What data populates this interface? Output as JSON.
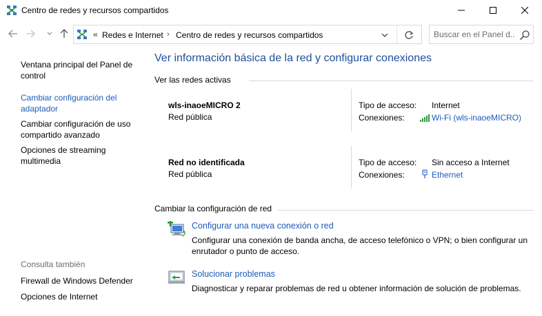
{
  "window": {
    "title": "Centro de redes y recursos compartidos",
    "icon": "network-sharing-center-icon"
  },
  "address_bar": {
    "overflow": "«",
    "breadcrumbs": [
      "Redes e Internet",
      "Centro de redes y recursos compartidos"
    ],
    "search_placeholder": "Buscar en el Panel d..."
  },
  "sidebar": {
    "links": [
      "Ventana principal del Panel de control",
      "Cambiar configuración del adaptador",
      "Cambiar configuración de uso compartido avanzado",
      "Opciones de streaming multimedia"
    ],
    "see_also_label": "Consulta también",
    "see_also": [
      "Firewall de Windows Defender",
      "Opciones de Internet"
    ]
  },
  "main": {
    "title": "Ver información básica de la red y configurar conexiones",
    "active_networks_label": "Ver las redes activas",
    "networks": [
      {
        "name": "wls-inaoeMICRO 2",
        "category": "Red pública",
        "access_type_label": "Tipo de acceso:",
        "access_type": "Internet",
        "connections_label": "Conexiones:",
        "connection": "Wi-Fi (wls-inaoeMICRO)",
        "connection_icon": "wifi-signal-icon"
      },
      {
        "name": "Red no identificada",
        "category": "Red pública",
        "access_type_label": "Tipo de acceso:",
        "access_type": "Sin acceso a Internet",
        "connections_label": "Conexiones:",
        "connection": "Ethernet",
        "connection_icon": "ethernet-plug-icon"
      }
    ],
    "change_settings_label": "Cambiar la configuración de red",
    "tasks": [
      {
        "title": "Configurar una nueva conexión o red",
        "description": "Configurar una conexión de banda ancha, de acceso telefónico o VPN; o bien configurar un enrutador o punto de acceso.",
        "icon": "new-connection-icon"
      },
      {
        "title": "Solucionar problemas",
        "description": "Diagnosticar y reparar problemas de red u obtener información de solución de problemas.",
        "icon": "troubleshoot-icon"
      }
    ]
  },
  "colors": {
    "link": "#1e5bb8",
    "title": "#1e4e9c",
    "divider": "#d9d9d9"
  }
}
